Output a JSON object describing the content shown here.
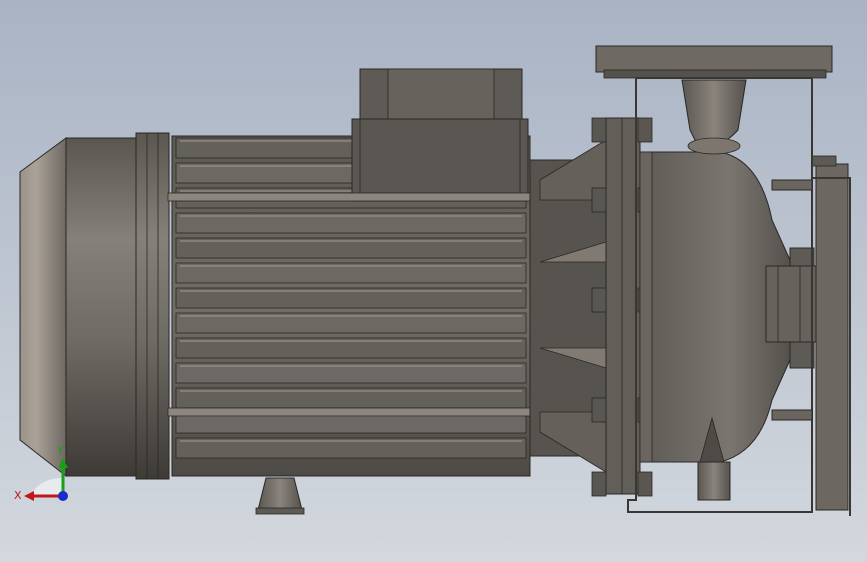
{
  "view": {
    "background_top": "#a9b3c4",
    "background_bottom": "#d3d8de"
  },
  "triad": {
    "x_label": "X",
    "y_label": "Y",
    "x_color": "#c01818",
    "y_color": "#18a018",
    "z_color": "#1a2acc"
  },
  "model": {
    "body_color": "#6f6b66",
    "highlight_color": "#a49d94",
    "edge_color": "#2a2824"
  }
}
